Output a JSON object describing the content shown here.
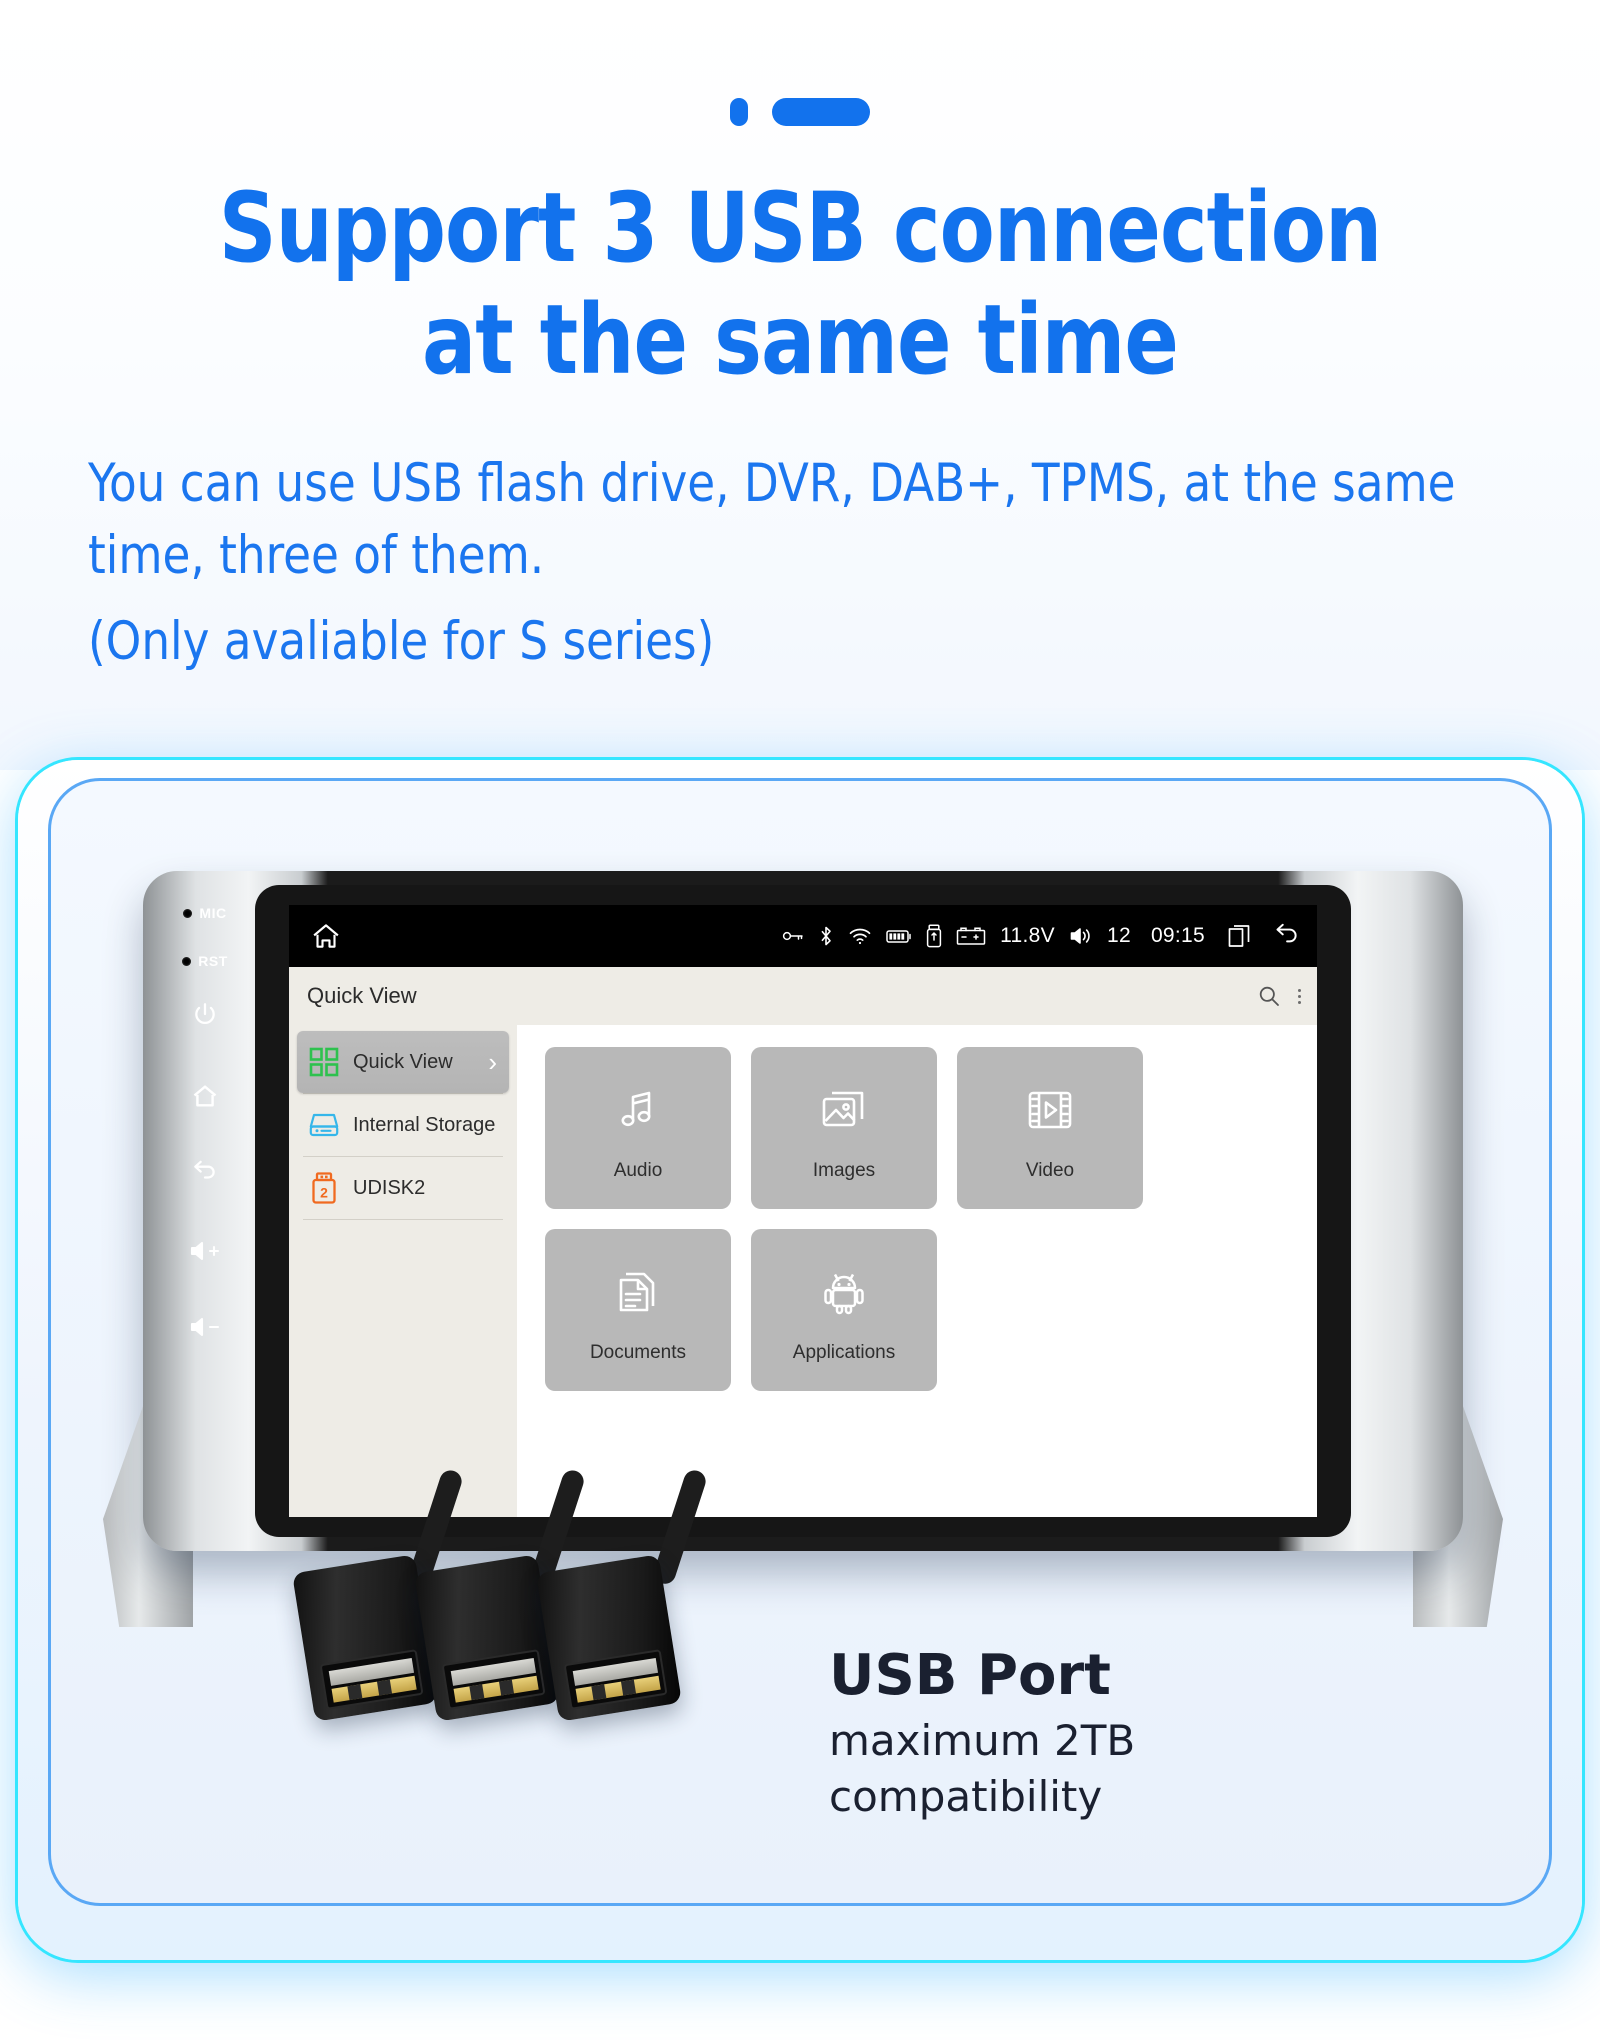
{
  "hero": {
    "headline_line1": "Support 3 USB connection",
    "headline_line2": "at the same time",
    "subtitle": "You can use USB flash drive, DVR, DAB+, TPMS, at the same time, three of them.",
    "note": "(Only avaliable for S series)",
    "accent_color": "#1272ed"
  },
  "device": {
    "hardware_keys": [
      {
        "name": "mic",
        "label": "MIC",
        "type": "pinhole"
      },
      {
        "name": "reset",
        "label": "RST",
        "type": "pinhole"
      },
      {
        "name": "power",
        "label": "",
        "type": "icon"
      },
      {
        "name": "home",
        "label": "",
        "type": "icon"
      },
      {
        "name": "back",
        "label": "",
        "type": "icon"
      },
      {
        "name": "volume-up",
        "label": "",
        "type": "icon"
      },
      {
        "name": "volume-down",
        "label": "",
        "type": "icon"
      }
    ],
    "statusbar": {
      "home_icon": "home-icon",
      "icons": [
        "key-icon",
        "bluetooth-icon",
        "wifi-icon",
        "battery-icon",
        "usb-drive-icon",
        "car-battery-icon"
      ],
      "voltage": "11.8V",
      "volume_icon": "volume-icon",
      "volume_level": "12",
      "clock": "09:15",
      "recents_icon": "recent-apps-icon",
      "back_icon": "back-arrow-icon"
    },
    "appbar": {
      "title": "Quick View",
      "search_icon": "search-icon",
      "overflow_icon": "overflow-menu-icon"
    },
    "sidebar": [
      {
        "label": "Quick View",
        "icon": "grid-icon",
        "icon_color": "#2ec14e",
        "selected": true,
        "chevron": "›"
      },
      {
        "label": "Internal Storage",
        "icon": "hard-drive-icon",
        "icon_color": "#35b6ea",
        "selected": false,
        "chevron": ""
      },
      {
        "label": "UDISK2",
        "icon": "usb-stick-icon",
        "icon_color": "#f06a20",
        "selected": false,
        "chevron": ""
      }
    ],
    "tiles": [
      {
        "label": "Audio",
        "icon": "music-note-icon"
      },
      {
        "label": "Images",
        "icon": "image-icon"
      },
      {
        "label": "Video",
        "icon": "film-play-icon"
      },
      {
        "label": "Documents",
        "icon": "documents-icon"
      },
      {
        "label": "Applications",
        "icon": "android-robot-icon"
      }
    ]
  },
  "usb_caption": {
    "title": "USB Port",
    "subtitle": "maximum 2TB compatibility",
    "port_count": 3
  }
}
